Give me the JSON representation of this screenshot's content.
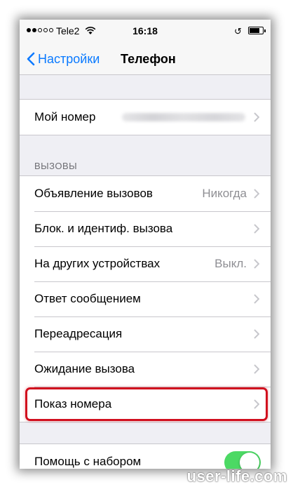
{
  "status_bar": {
    "carrier": "Tele2",
    "time": "16:18",
    "battery_level": 0.9
  },
  "nav": {
    "back_label": "Настройки",
    "title": "Телефон"
  },
  "my_number": {
    "label": "Мой номер"
  },
  "calls_section": {
    "header": "ВЫЗОВЫ",
    "items": [
      {
        "label": "Объявление вызовов",
        "value": "Никогда"
      },
      {
        "label": "Блок. и идентиф. вызова",
        "value": ""
      },
      {
        "label": "На других устройствах",
        "value": "Выкл."
      },
      {
        "label": "Ответ сообщением",
        "value": ""
      },
      {
        "label": "Переадресация",
        "value": ""
      },
      {
        "label": "Ожидание вызова",
        "value": ""
      },
      {
        "label": "Показ номера",
        "value": ""
      }
    ]
  },
  "next_section": {
    "partial_label": "Помощь с набором",
    "toggle_on": true
  },
  "watermark": "user-life.com",
  "colors": {
    "accent": "#0a7aff",
    "highlight": "#d10f1e",
    "toggle_on": "#4cd964"
  }
}
